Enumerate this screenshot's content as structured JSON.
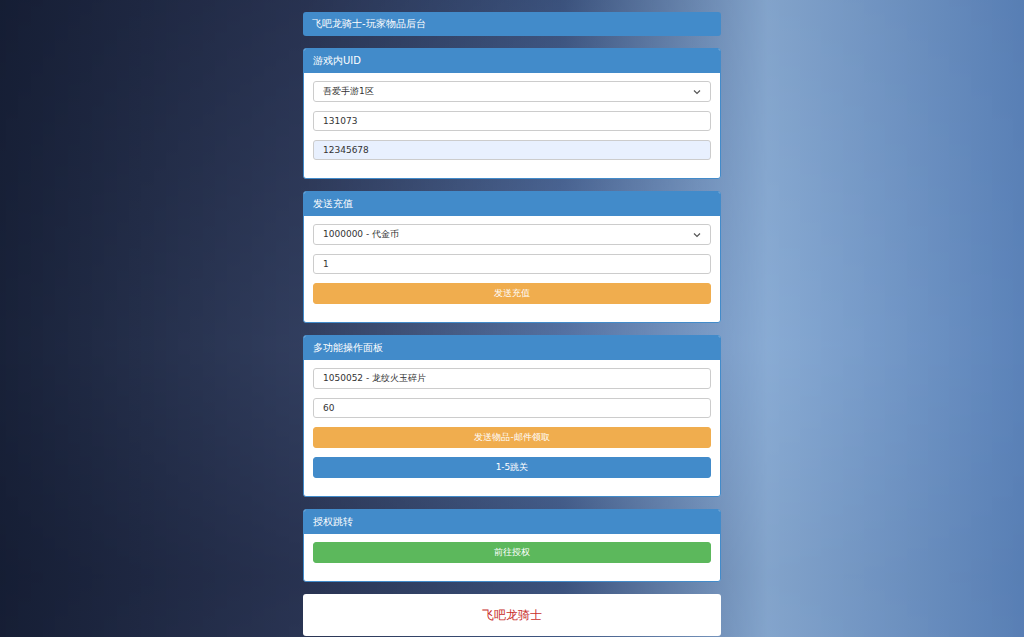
{
  "title": "飞吧龙骑士-玩家物品后台",
  "panels": [
    {
      "title": "游戏内UID",
      "fields": [
        {
          "kind": "select",
          "value": "吾爱手游1区",
          "autofilled": false
        },
        {
          "kind": "input",
          "value": "131073",
          "autofilled": false
        },
        {
          "kind": "input",
          "value": "12345678",
          "autofilled": true
        }
      ],
      "buttons": []
    },
    {
      "title": "发送充值",
      "fields": [
        {
          "kind": "select",
          "value": "1000000 - 代金币",
          "autofilled": false
        },
        {
          "kind": "input",
          "value": "1",
          "autofilled": false
        }
      ],
      "buttons": [
        {
          "label": "发送充值",
          "color": "#f0ad4e"
        }
      ]
    },
    {
      "title": "多功能操作面板",
      "fields": [
        {
          "kind": "input",
          "value": "1050052 - 龙纹火玉碎片",
          "autofilled": false
        },
        {
          "kind": "input",
          "value": "60",
          "autofilled": false
        }
      ],
      "buttons": [
        {
          "label": "发送物品-邮件领取",
          "color": "#f0ad4e"
        },
        {
          "label": "1-5跳关",
          "color": "#428bca"
        }
      ]
    },
    {
      "title": "授权跳转",
      "fields": [],
      "buttons": [
        {
          "label": "前往授权",
          "color": "#5cb85c"
        }
      ]
    }
  ],
  "footer": "飞吧龙骑士"
}
